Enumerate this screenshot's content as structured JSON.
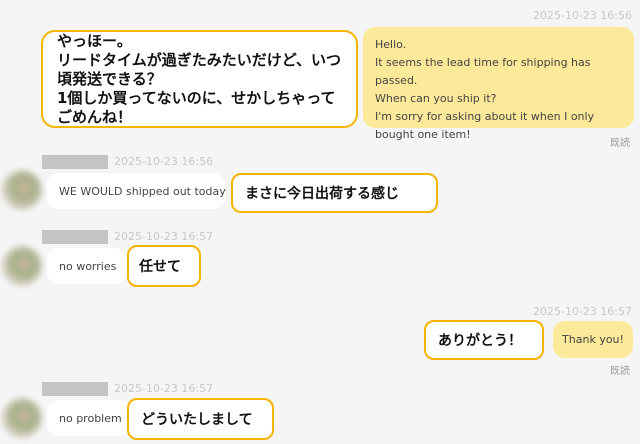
{
  "messages": {
    "out1": {
      "timestamp": "2025-10-23 16:56",
      "lines": [
        "Hello.",
        "It seems the lead time for shipping has passed.",
        "When can you ship it?",
        "I'm sorry for asking about it when I only",
        "bought one item!"
      ],
      "read": "既読"
    },
    "in1": {
      "timestamp": "2025-10-23 16:56",
      "text": "WE WOULD shipped out today"
    },
    "in2": {
      "timestamp": "2025-10-23 16:57",
      "text": "no worries"
    },
    "out2": {
      "timestamp": "2025-10-23 16:57",
      "text": "Thank you!",
      "read": "既読"
    },
    "in3": {
      "timestamp": "2025-10-23 16:57",
      "text": "no problem"
    }
  },
  "annotations": {
    "a1": [
      "やっほー。",
      "リードタイムが過ぎたみたいだけど、いつ",
      "頃発送できる？",
      "1個しか買ってないのに、せかしちゃって",
      "ごめんね！"
    ],
    "a2": "まさに今日出荷する感じ",
    "a3": "任せて",
    "a4": "ありがとう！",
    "a5": "どういたしまして"
  },
  "colors": {
    "background": "#f5f5f5",
    "outgoing_bubble": "#fde99a",
    "incoming_bubble": "#ffffff",
    "annotation_border": "#f4b400"
  }
}
